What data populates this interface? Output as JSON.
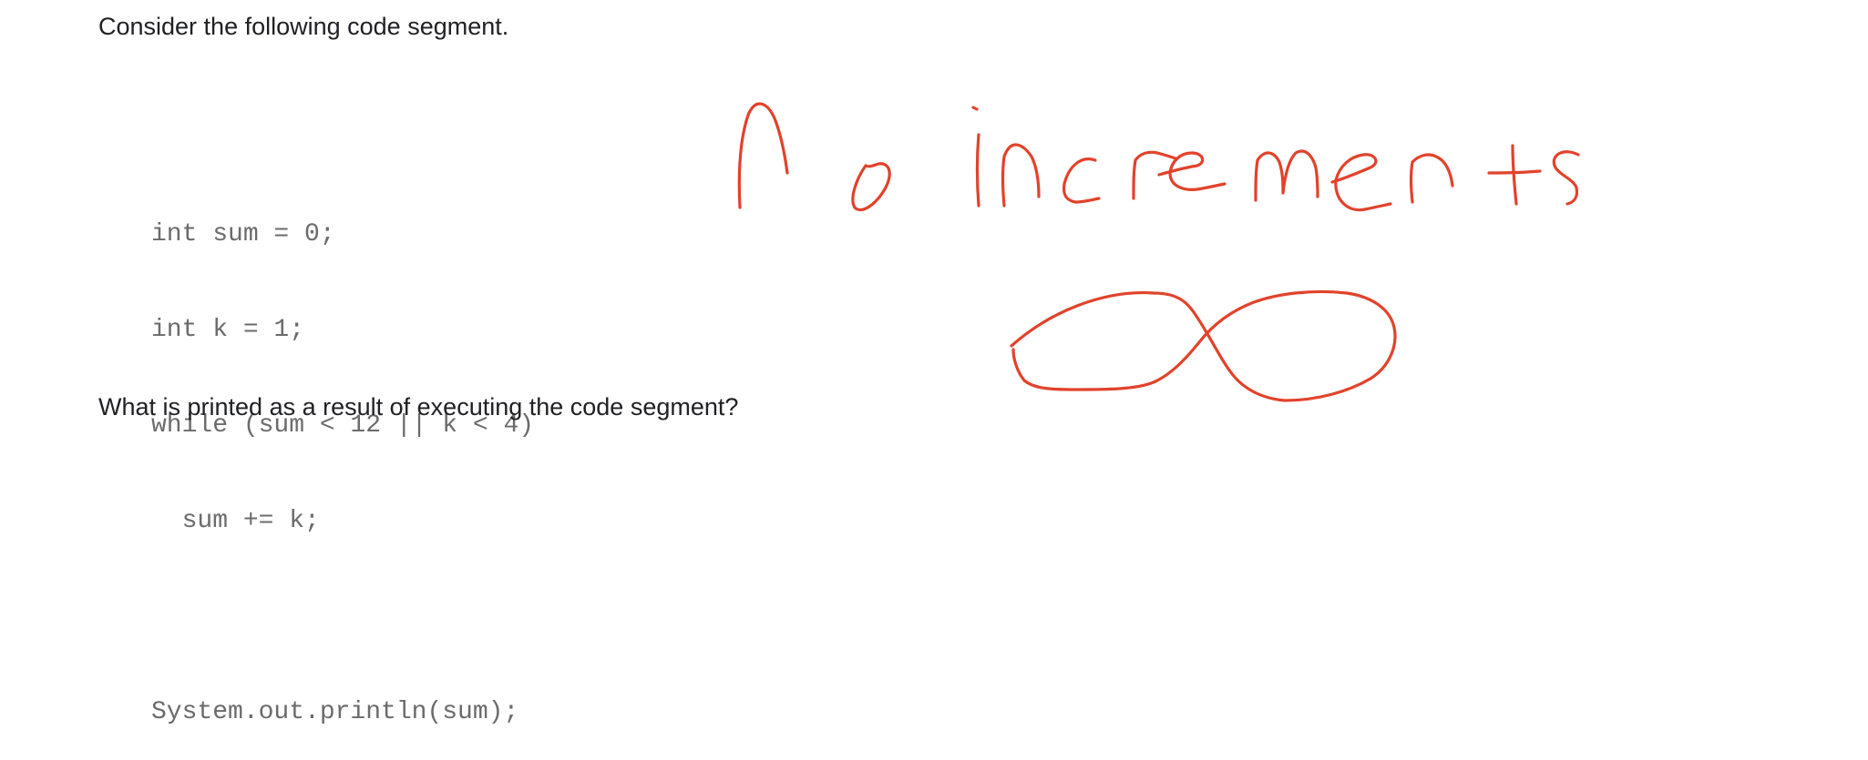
{
  "question": {
    "prompt": "Consider the following code segment.",
    "footer": "What is printed as a result of executing the code segment?"
  },
  "code": {
    "lines": [
      "int sum = 0;",
      "int k = 1;",
      "while (sum < 12 || k < 4)",
      "  sum += k;",
      "",
      "System.out.println(sum);"
    ]
  },
  "annotations": {
    "handwritten_note": "no increments",
    "infinity_symbol": "infinity-sketch",
    "ink_color": "#e2422b"
  },
  "colors": {
    "text": "#202124",
    "code_text": "#6b6b6b",
    "background": "#ffffff"
  }
}
